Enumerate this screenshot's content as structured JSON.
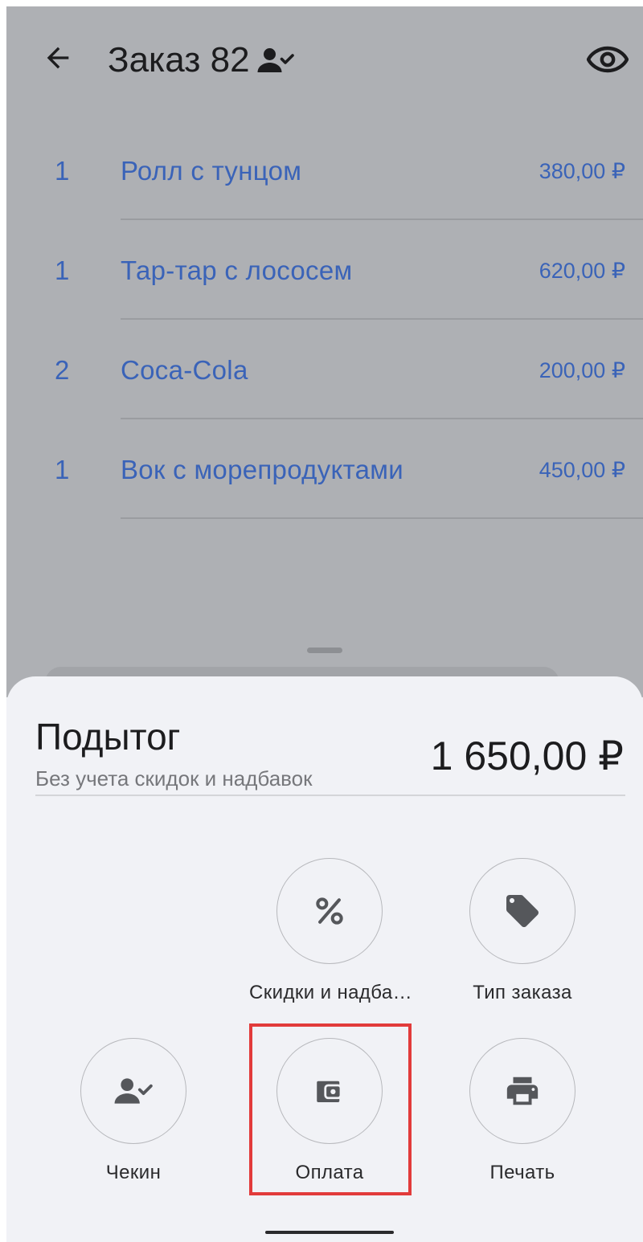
{
  "header": {
    "title": "Заказ 82"
  },
  "order_items": [
    {
      "qty": "1",
      "name": "Ролл с тунцом",
      "price": "380,00 ₽"
    },
    {
      "qty": "1",
      "name": "Тар-тар с лососем",
      "price": "620,00 ₽"
    },
    {
      "qty": "2",
      "name": "Coca-Cola",
      "price": "200,00 ₽"
    },
    {
      "qty": "1",
      "name": "Вок с морепродуктами",
      "price": "450,00 ₽"
    }
  ],
  "sheet": {
    "subtotal_label": "Подытог",
    "subtotal_note": "Без учета скидок и надбавок",
    "subtotal_value": "1 650,00 ₽",
    "actions": {
      "discounts": "Скидки и надба…",
      "order_type": "Тип заказа",
      "checkin": "Чекин",
      "payment": "Оплата",
      "print": "Печать"
    }
  },
  "colors": {
    "accent_text": "#3a63b8",
    "scrim": "#aeb0b4",
    "sheet_bg": "#f1f2f6",
    "highlight": "#e23b3b",
    "icon": "#55575b"
  }
}
